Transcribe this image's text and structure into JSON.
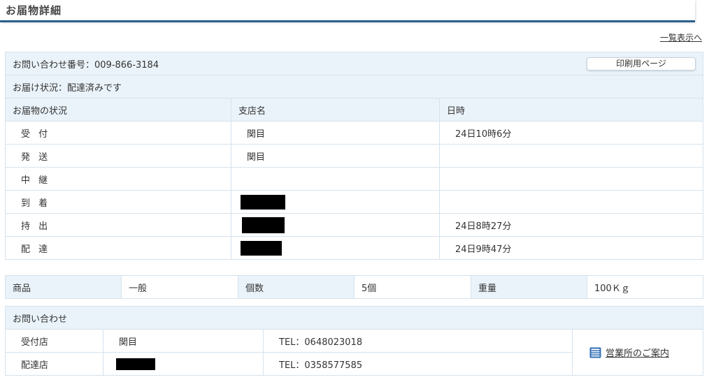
{
  "header": {
    "title": "お届物詳細"
  },
  "back_link": "一覧表示へ",
  "inquiry": {
    "label_number": "お問い合わせ番号：009-866-3184",
    "print_button": "印刷用ページ"
  },
  "status": {
    "text": "お届け状況：配達済みです"
  },
  "tracking": {
    "headers": [
      "お届物の状況",
      "支店名",
      "日時"
    ],
    "rows": [
      {
        "status": "受 付",
        "branch": "関目",
        "datetime": "24日10時6分"
      },
      {
        "status": "発 送",
        "branch": "関目",
        "datetime": ""
      },
      {
        "status": "中 継",
        "branch": "",
        "datetime": ""
      },
      {
        "status": "到 着",
        "branch": "",
        "datetime": ""
      },
      {
        "status": "持 出",
        "branch": "",
        "datetime": "24日8時27分"
      },
      {
        "status": "配 達",
        "branch": "",
        "datetime": "24日9時47分"
      }
    ]
  },
  "goods": {
    "product_label": "商品",
    "product_value": "一般",
    "count_label": "個数",
    "count_value": "5個",
    "weight_label": "重量",
    "weight_value": "100Ｋｇ"
  },
  "contact": {
    "title": "お問い合わせ",
    "receive_label": "受付店",
    "receive_store": "関目",
    "receive_tel": "TEL：0648023018",
    "delivery_label": "配達店",
    "delivery_tel": "TEL：0358577585",
    "office_link": "営業所のご案内"
  },
  "icons": {
    "office_icon": "document-icon"
  },
  "colors": {
    "header_border": "#2b5f8f",
    "row_bg": "#eaf3fa",
    "border": "#d6e2ec"
  }
}
